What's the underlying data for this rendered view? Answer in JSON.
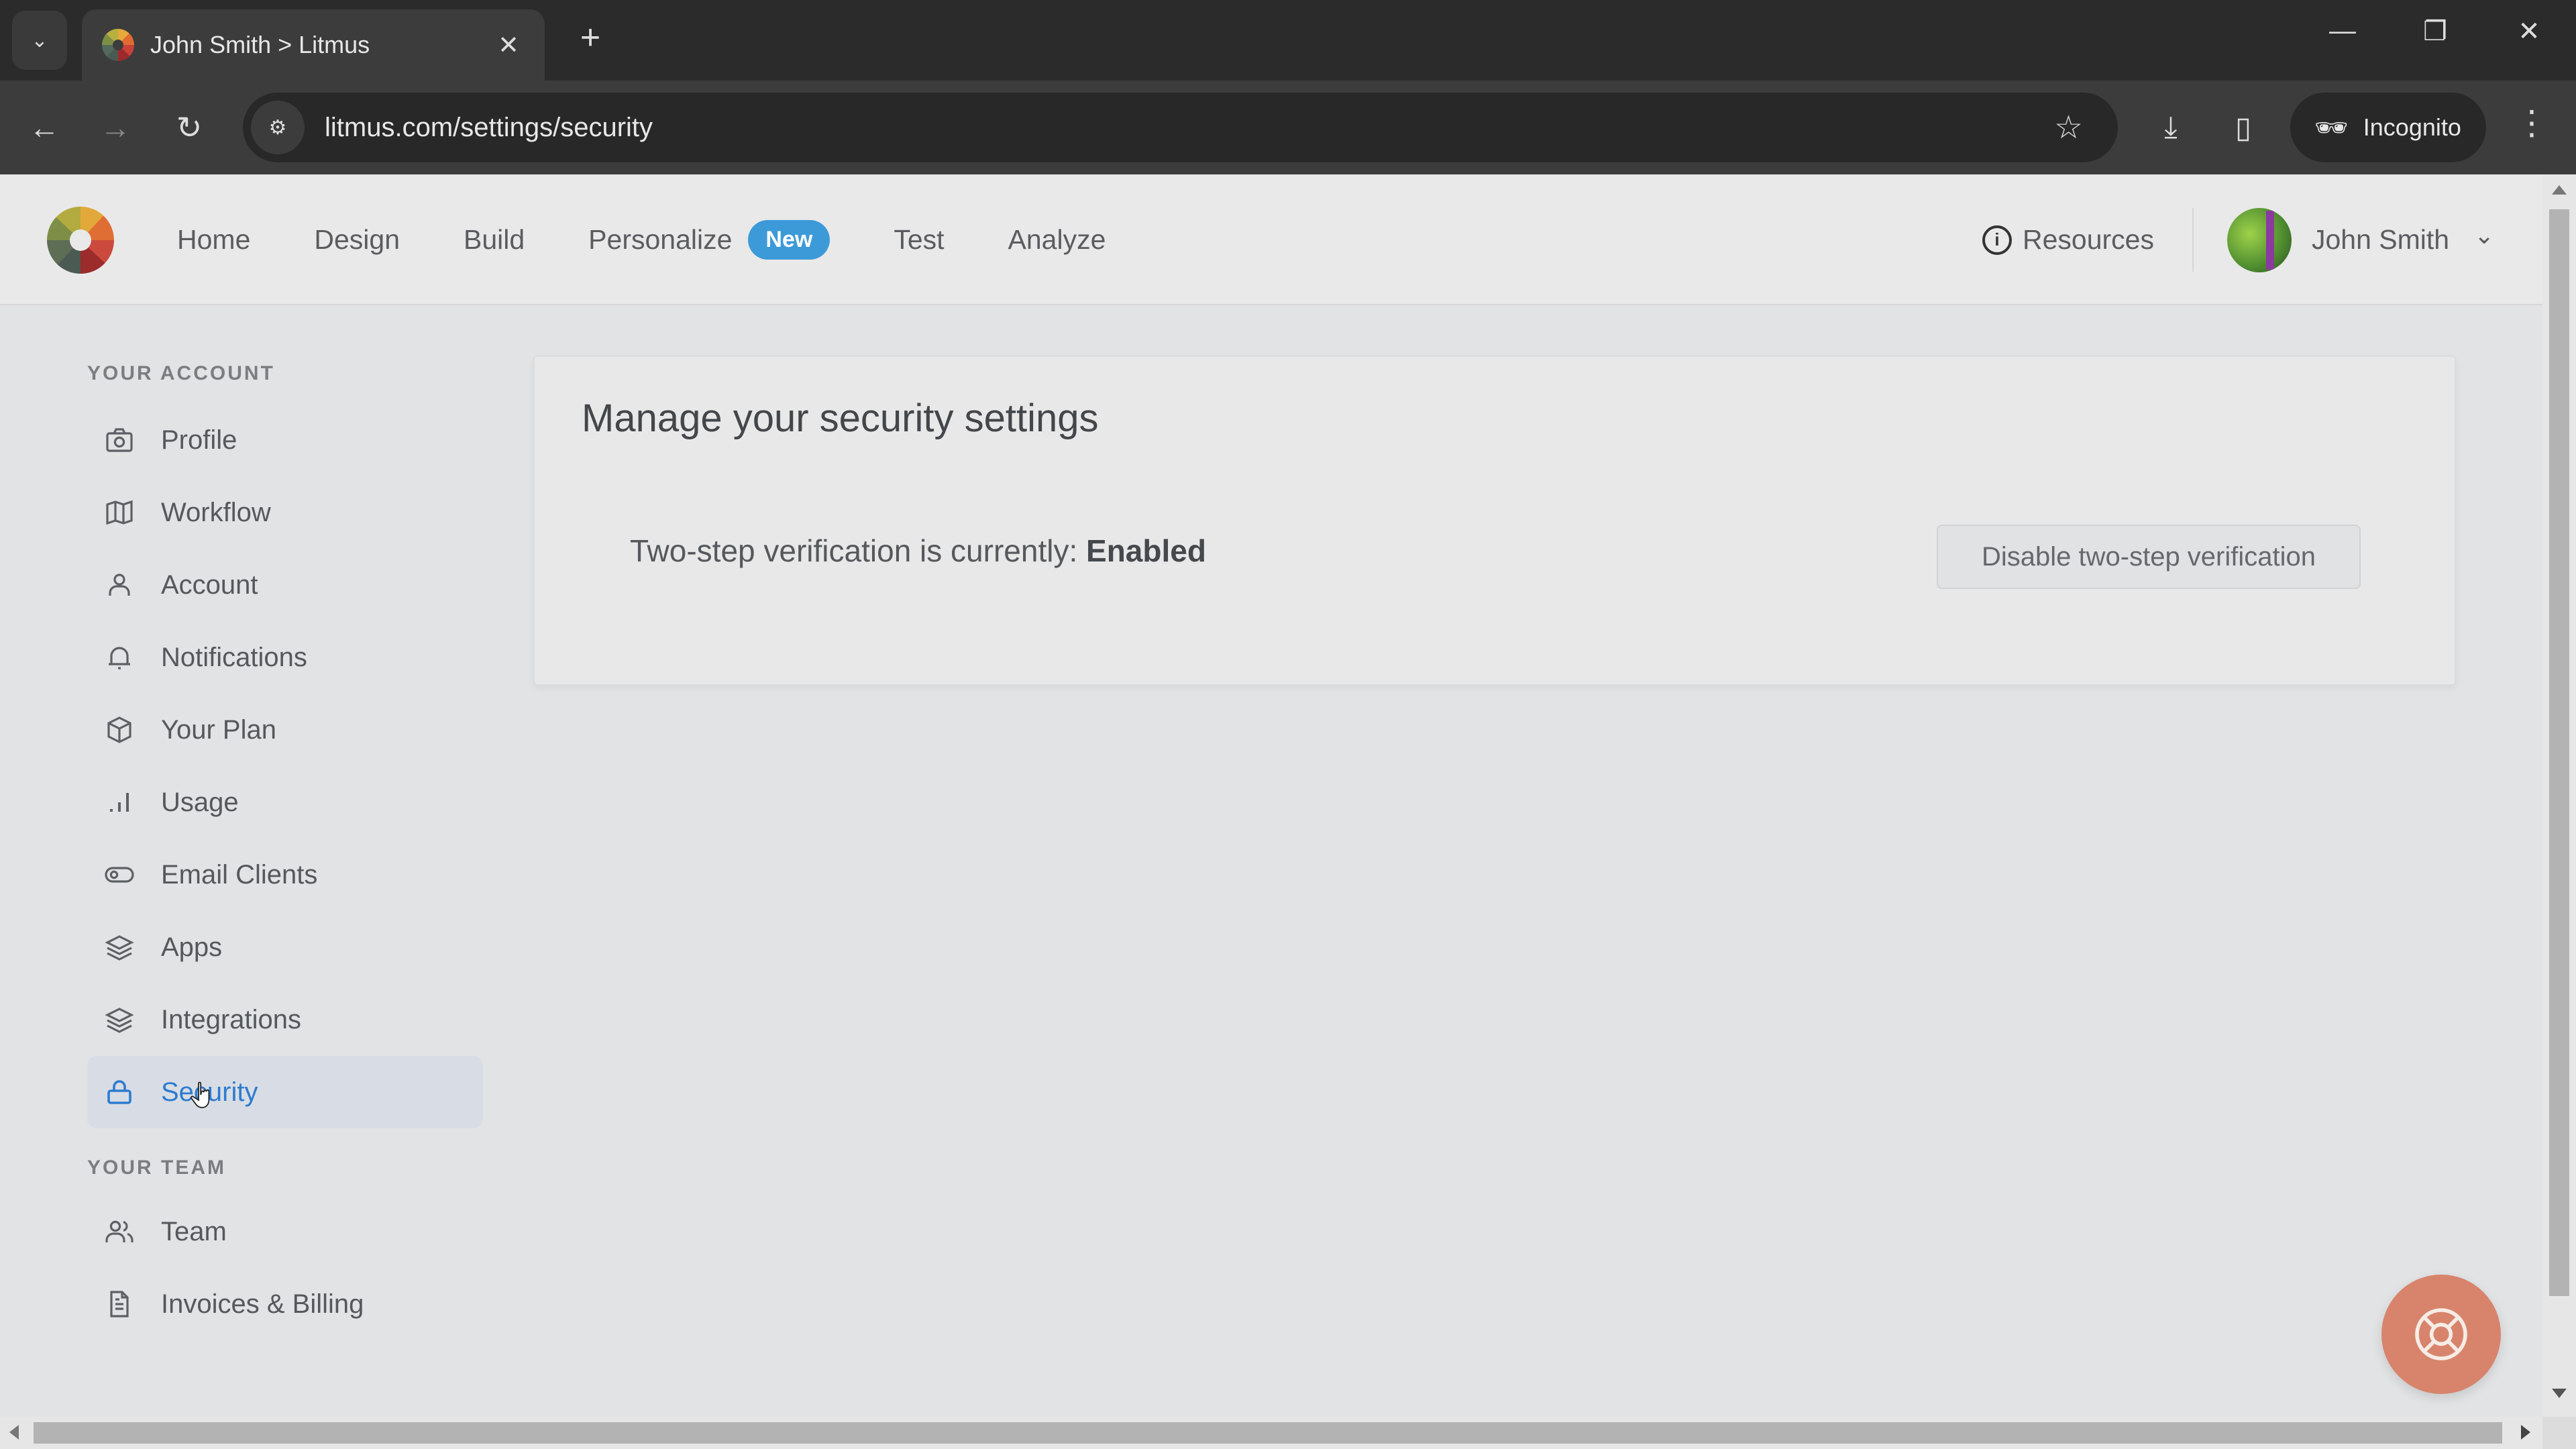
{
  "browser": {
    "tab_title": "John Smith > Litmus",
    "url": "litmus.com/settings/security",
    "incognito_label": "Incognito"
  },
  "header": {
    "nav": [
      {
        "label": "Home"
      },
      {
        "label": "Design"
      },
      {
        "label": "Build"
      },
      {
        "label": "Personalize",
        "badge": "New"
      },
      {
        "label": "Test"
      },
      {
        "label": "Analyze"
      }
    ],
    "resources_label": "Resources",
    "user_name": "John Smith"
  },
  "sidebar": {
    "account_section": "YOUR ACCOUNT",
    "account_items": [
      {
        "label": "Profile",
        "icon": "camera-icon"
      },
      {
        "label": "Workflow",
        "icon": "map-icon"
      },
      {
        "label": "Account",
        "icon": "user-icon"
      },
      {
        "label": "Notifications",
        "icon": "bell-icon"
      },
      {
        "label": "Your Plan",
        "icon": "box-icon"
      },
      {
        "label": "Usage",
        "icon": "bar-chart-icon"
      },
      {
        "label": "Email Clients",
        "icon": "toggle-icon"
      },
      {
        "label": "Apps",
        "icon": "layers-icon"
      },
      {
        "label": "Integrations",
        "icon": "layers-icon"
      },
      {
        "label": "Security",
        "icon": "lock-icon",
        "active": true
      }
    ],
    "team_section": "YOUR TEAM",
    "team_items": [
      {
        "label": "Team",
        "icon": "users-icon"
      },
      {
        "label": "Invoices & Billing",
        "icon": "document-icon"
      }
    ]
  },
  "main": {
    "title": "Manage your security settings",
    "status_prefix": "Two-step verification is currently: ",
    "status_value": "Enabled",
    "disable_button": "Disable two-step verification"
  },
  "colors": {
    "accent": "#2d7bd0",
    "badge": "#3d9ad8",
    "help_button": "#d8846c"
  }
}
